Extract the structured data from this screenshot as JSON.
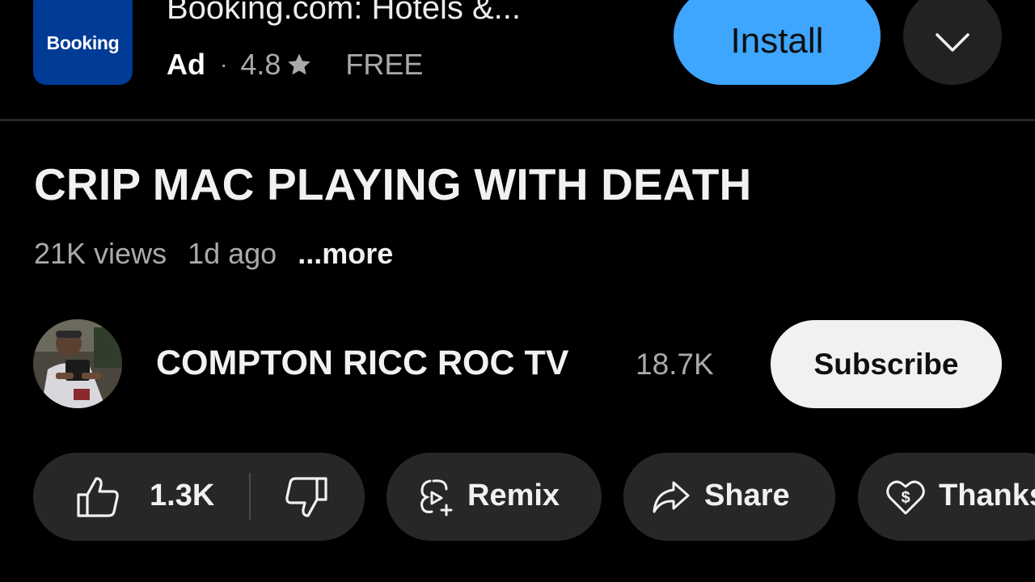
{
  "ad": {
    "logo_text": "Booking",
    "title": "Booking.com: Hotels &...",
    "label": "Ad",
    "separator": "·",
    "rating": "4.8",
    "price": "FREE",
    "install_label": "Install",
    "icons": {
      "star": "star-icon",
      "expand": "chevron-down-icon"
    },
    "colors": {
      "logo_bg": "#003b95",
      "install_bg": "#3ea6ff"
    }
  },
  "video": {
    "title": "CRIP MAC PLAYING WITH DEATH",
    "views": "21K views",
    "age": "1d ago",
    "more_label": "...more"
  },
  "channel": {
    "name": "COMPTON RICC ROC TV",
    "subscribers": "18.7K",
    "subscribe_label": "Subscribe"
  },
  "actions": {
    "like_count": "1.3K",
    "remix_label": "Remix",
    "share_label": "Share",
    "thanks_label": "Thanks",
    "icons": {
      "like": "thumbs-up-icon",
      "dislike": "thumbs-down-icon",
      "remix": "remix-icon",
      "share": "share-arrow-icon",
      "thanks": "heart-dollar-icon"
    }
  }
}
